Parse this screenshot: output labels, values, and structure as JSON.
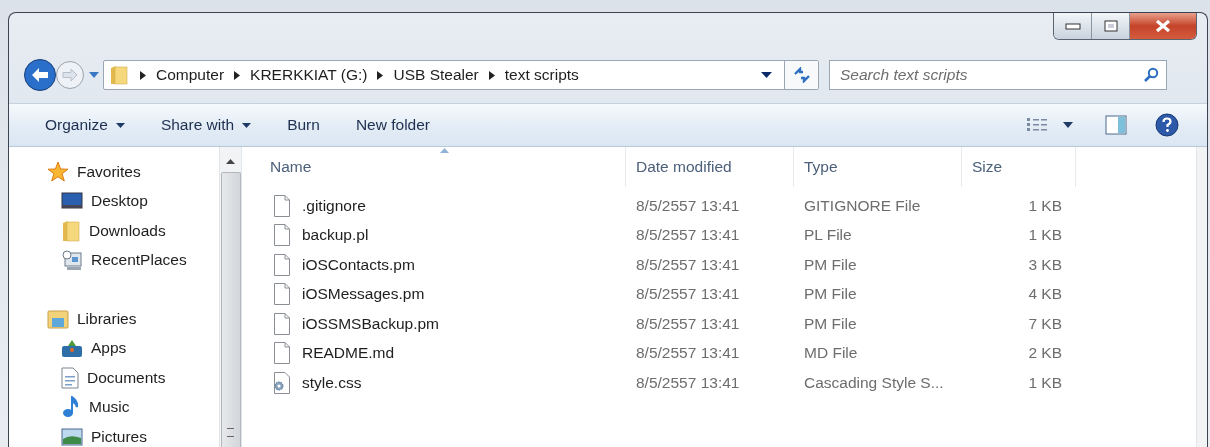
{
  "address_bar": {
    "path": [
      "Computer",
      "KRERKKIAT (G:)",
      "USB Stealer",
      "text scripts"
    ]
  },
  "search": {
    "placeholder": "Search text scripts"
  },
  "toolbar": {
    "commands": [
      {
        "label": "Organize",
        "dropdown": true
      },
      {
        "label": "Share with",
        "dropdown": true
      },
      {
        "label": "Burn",
        "dropdown": false
      },
      {
        "label": "New folder",
        "dropdown": false
      }
    ]
  },
  "navigation": {
    "sections": [
      {
        "label": "Favorites",
        "kind": "star",
        "items": [
          {
            "label": "Desktop",
            "kind": "desktop"
          },
          {
            "label": "Downloads",
            "kind": "folder"
          },
          {
            "label": "RecentPlaces",
            "kind": "recent"
          }
        ]
      },
      {
        "label": "Libraries",
        "kind": "library",
        "items": [
          {
            "label": "Apps",
            "kind": "apps"
          },
          {
            "label": "Documents",
            "kind": "document"
          },
          {
            "label": "Music",
            "kind": "music"
          },
          {
            "label": "Pictures",
            "kind": "pictures"
          }
        ]
      }
    ]
  },
  "file_list": {
    "columns": [
      {
        "label": "Name",
        "sorted": true
      },
      {
        "label": "Date modified",
        "sorted": false
      },
      {
        "label": "Type",
        "sorted": false
      },
      {
        "label": "Size",
        "sorted": false
      }
    ],
    "rows": [
      {
        "name": ".gitignore",
        "kind": "file",
        "date": "8/5/2557 13:41",
        "type": "GITIGNORE File",
        "size": "1 KB"
      },
      {
        "name": "backup.pl",
        "kind": "file",
        "date": "8/5/2557 13:41",
        "type": "PL File",
        "size": "1 KB"
      },
      {
        "name": "iOSContacts.pm",
        "kind": "file",
        "date": "8/5/2557 13:41",
        "type": "PM File",
        "size": "3 KB"
      },
      {
        "name": "iOSMessages.pm",
        "kind": "file",
        "date": "8/5/2557 13:41",
        "type": "PM File",
        "size": "4 KB"
      },
      {
        "name": "iOSSMSBackup.pm",
        "kind": "file",
        "date": "8/5/2557 13:41",
        "type": "PM File",
        "size": "7 KB"
      },
      {
        "name": "README.md",
        "kind": "file",
        "date": "8/5/2557 13:41",
        "type": "MD File",
        "size": "2 KB"
      },
      {
        "name": "style.css",
        "kind": "settings-file",
        "date": "8/5/2557 13:41",
        "type": "Cascading Style S...",
        "size": "1 KB"
      }
    ]
  }
}
